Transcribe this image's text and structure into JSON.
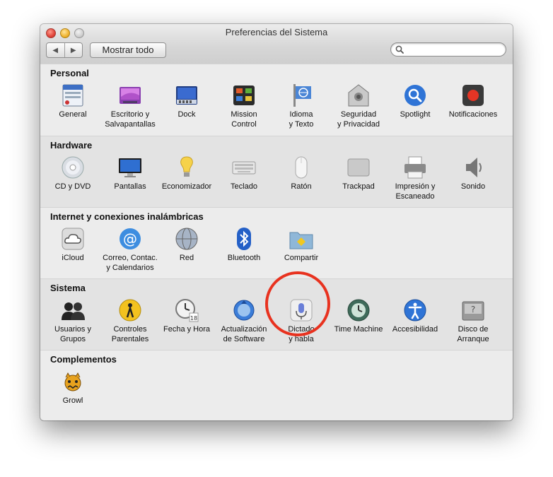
{
  "window": {
    "title": "Preferencias del Sistema"
  },
  "toolbar": {
    "back": "◀",
    "forward": "▶",
    "show_all": "Mostrar todo",
    "search_placeholder": ""
  },
  "sections": [
    {
      "title": "Personal",
      "items": [
        {
          "label": "General",
          "icon": "general-icon"
        },
        {
          "label": "Escritorio y\nSalvapantallas",
          "icon": "desktop-icon"
        },
        {
          "label": "Dock",
          "icon": "dock-icon"
        },
        {
          "label": "Mission\nControl",
          "icon": "mission-control-icon"
        },
        {
          "label": "Idioma\ny Texto",
          "icon": "language-icon"
        },
        {
          "label": "Seguridad\ny Privacidad",
          "icon": "security-icon"
        },
        {
          "label": "Spotlight",
          "icon": "spotlight-icon"
        },
        {
          "label": "Notificaciones",
          "icon": "notifications-icon"
        }
      ]
    },
    {
      "title": "Hardware",
      "items": [
        {
          "label": "CD y DVD",
          "icon": "cd-icon"
        },
        {
          "label": "Pantallas",
          "icon": "display-icon"
        },
        {
          "label": "Economizador",
          "icon": "bulb-icon"
        },
        {
          "label": "Teclado",
          "icon": "keyboard-icon"
        },
        {
          "label": "Ratón",
          "icon": "mouse-icon"
        },
        {
          "label": "Trackpad",
          "icon": "trackpad-icon"
        },
        {
          "label": "Impresión y\nEscaneado",
          "icon": "printer-icon"
        },
        {
          "label": "Sonido",
          "icon": "speaker-icon"
        }
      ]
    },
    {
      "title": "Internet y conexiones inalámbricas",
      "items": [
        {
          "label": "iCloud",
          "icon": "cloud-icon"
        },
        {
          "label": "Correo, Contac.\ny Calendarios",
          "icon": "at-icon"
        },
        {
          "label": "Red",
          "icon": "globe-icon"
        },
        {
          "label": "Bluetooth",
          "icon": "bluetooth-icon"
        },
        {
          "label": "Compartir",
          "icon": "folder-share-icon"
        }
      ]
    },
    {
      "title": "Sistema",
      "items": [
        {
          "label": "Usuarios y\nGrupos",
          "icon": "users-icon"
        },
        {
          "label": "Controles\nParentales",
          "icon": "parental-icon"
        },
        {
          "label": "Fecha y Hora",
          "icon": "clock-icon"
        },
        {
          "label": "Actualización\nde Software",
          "icon": "update-icon"
        },
        {
          "label": "Dictado\ny habla",
          "icon": "microphone-icon"
        },
        {
          "label": "Time Machine",
          "icon": "time-machine-icon"
        },
        {
          "label": "Accesibilidad",
          "icon": "accessibility-icon"
        },
        {
          "label": "Disco de\nArranque",
          "icon": "disk-icon"
        }
      ]
    },
    {
      "title": "Complementos",
      "items": [
        {
          "label": "Growl",
          "icon": "growl-icon"
        }
      ]
    }
  ],
  "colors": {
    "highlight": "#e8321f"
  }
}
